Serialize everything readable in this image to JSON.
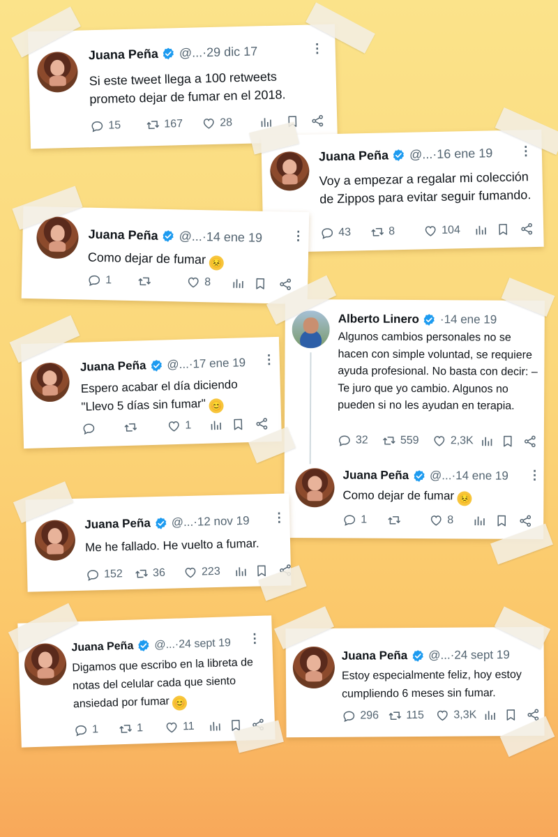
{
  "colors": {
    "verified": "#1d9bf0",
    "text": "#0f1419",
    "muted": "#536471"
  },
  "tweets": [
    {
      "name": "Juana Peña",
      "handle": "@...",
      "date": "29 dic 17",
      "text": "Si este tweet llega a 100 retweets prometo dejar de fumar en el 2018.",
      "replies": "15",
      "retweets": "167",
      "likes": "28"
    },
    {
      "name": "Juana Peña",
      "handle": "@...",
      "date": "16 ene 19",
      "text": "Voy a empezar a regalar mi colección de Zippos para evitar seguir fumando.",
      "replies": "43",
      "retweets": "8",
      "likes": "104"
    },
    {
      "name": "Juana Peña",
      "handle": "@...",
      "date": "14 ene 19",
      "text": "Como dejar de fumar",
      "emoji": "😣",
      "replies": "1",
      "retweets": "",
      "likes": "8"
    },
    {
      "name": "Juana Peña",
      "handle": "@...",
      "date": "17 ene 19",
      "text": "Espero acabar el día diciendo \"Llevo 5 días sin fumar\"",
      "emoji": "😊",
      "replies": "",
      "retweets": "",
      "likes": "1"
    },
    {
      "name": "Alberto Linero",
      "handle": "",
      "date": "14 ene 19",
      "text": "Algunos cambios personales no se hacen con simple voluntad, se requiere ayuda profesional. No basta con decir: – Te juro que yo cambio. Algunos no pueden si no les ayudan en terapia.",
      "replies": "32",
      "retweets": "559",
      "likes": "2,3K"
    },
    {
      "name": "Juana Peña",
      "handle": "@...",
      "date": "14 ene 19",
      "text": "Como dejar de fumar",
      "emoji": "😣",
      "replies": "1",
      "retweets": "",
      "likes": "8"
    },
    {
      "name": "Juana Peña",
      "handle": "@...",
      "date": "12 nov 19",
      "text": "Me he fallado. He vuelto a fumar.",
      "replies": "152",
      "retweets": "36",
      "likes": "223"
    },
    {
      "name": "Juana Peña",
      "handle": "@...",
      "date": "24 sept 19",
      "text": "Digamos que escribo en la libreta de notas del celular cada que siento ansiedad por fumar",
      "emoji": "😊",
      "replies": "1",
      "retweets": "1",
      "likes": "11"
    },
    {
      "name": "Juana Peña",
      "handle": "@...",
      "date": "24 sept 19",
      "text": "Estoy especialmente feliz, hoy estoy cumpliendo 6 meses sin fumar.",
      "replies": "296",
      "retweets": "115",
      "likes": "3,3K"
    }
  ],
  "separator": " · ",
  "more": "⋮"
}
